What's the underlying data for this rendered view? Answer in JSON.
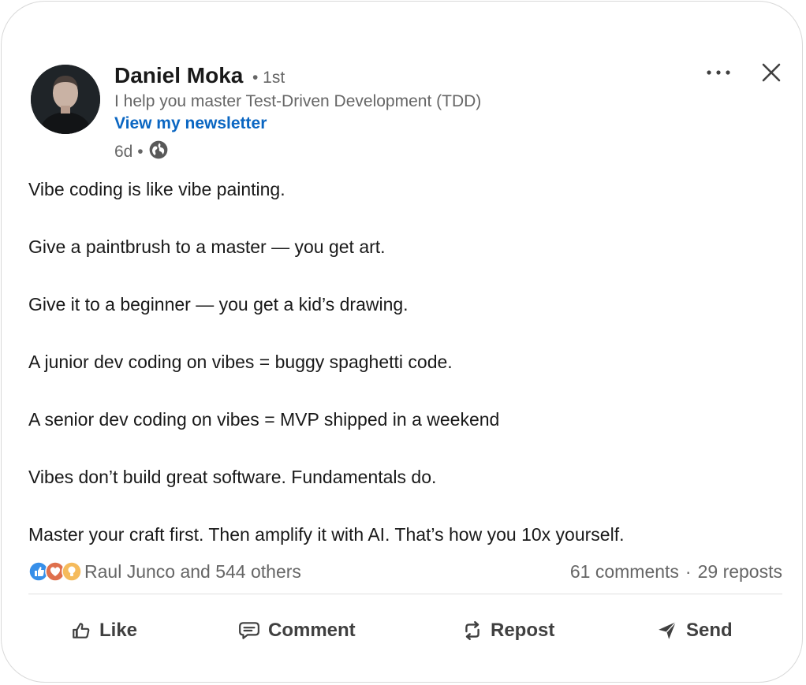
{
  "author": {
    "name": "Daniel Moka",
    "degree": "• 1st",
    "headline": "I help you master Test-Driven Development (TDD)",
    "newsletter_link": "View my newsletter",
    "time_ago": "6d •",
    "visibility_icon": "globe-icon"
  },
  "header_actions": {
    "more_icon": "more-horizontal-icon",
    "close_icon": "close-icon"
  },
  "post": {
    "lines": [
      "Vibe coding is like vibe painting.",
      "Give a paintbrush to a master — you get art.",
      "Give it to a beginner — you get a kid’s drawing.",
      "A junior dev coding on vibes = buggy spaghetti code.",
      "A senior dev coding on vibes = MVP shipped in a weekend",
      "Vibes don’t build great software. Fundamentals do.",
      "Master your craft first. Then amplify it with AI. That’s how you 10x yourself."
    ]
  },
  "social": {
    "reaction_icons": [
      "like-reaction-icon",
      "love-reaction-icon",
      "insightful-reaction-icon"
    ],
    "reactions_text": "Raul Junco and 544 others",
    "comments": "61 comments",
    "separator": "·",
    "reposts": "29 reposts"
  },
  "actions": {
    "like": "Like",
    "comment": "Comment",
    "repost": "Repost",
    "send": "Send"
  },
  "colors": {
    "link_blue": "#0a66c2",
    "text_primary": "#191919",
    "text_secondary": "#666666",
    "like_blue": "#378fe9",
    "love_red": "#df704d",
    "insight_yellow": "#f5bb5c"
  }
}
